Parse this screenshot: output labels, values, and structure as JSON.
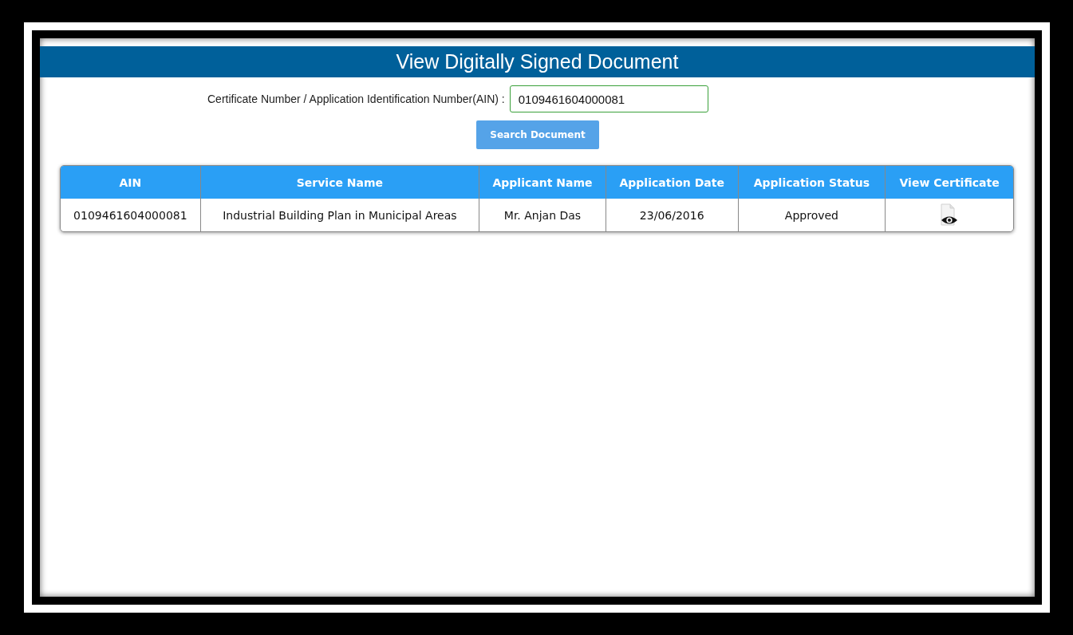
{
  "page": {
    "title": "View Digitally Signed Document"
  },
  "search": {
    "label": "Certificate Number / Application Identification Number(AIN) :",
    "value": "0109461604000081",
    "button": "Search Document"
  },
  "table": {
    "columns": [
      "AIN",
      "Service Name",
      "Applicant Name",
      "Application Date",
      "Application Status",
      "View Certificate"
    ],
    "rows": [
      {
        "ain": "0109461604000081",
        "service": "Industrial Building Plan in Municipal Areas",
        "applicant": "Mr. Anjan Das",
        "date": "23/06/2016",
        "status": "Approved"
      }
    ]
  }
}
